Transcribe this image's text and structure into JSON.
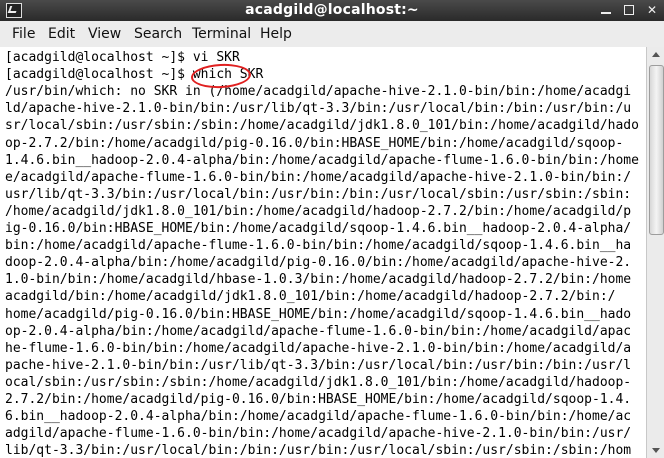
{
  "window": {
    "title": "acadgild@localhost:~",
    "app_icon": "terminal-icon",
    "buttons": [
      "minimize-icon",
      "maximize-icon",
      "close-icon"
    ]
  },
  "menubar": {
    "items": [
      "File",
      "Edit",
      "View",
      "Search",
      "Terminal",
      "Help"
    ]
  },
  "terminal": {
    "lines": [
      "[acadgild@localhost ~]$ vi SKR",
      "[acadgild@localhost ~]$ which SKR",
      "/usr/bin/which: no SKR in (/home/acadgild/apache-hive-2.1.0-bin/bin:/home/acadgi",
      "ld/apache-hive-2.1.0-bin/bin:/usr/lib/qt-3.3/bin:/usr/local/bin:/bin:/usr/bin:/u",
      "sr/local/sbin:/usr/sbin:/sbin:/home/acadgild/jdk1.8.0_101/bin:/home/acadgild/hado",
      "op-2.7.2/bin:/home/acadgild/pig-0.16.0/bin:HBASE_HOME/bin:/home/acadgild/sqoop-",
      "1.4.6.bin__hadoop-2.0.4-alpha/bin:/home/acadgild/apache-flume-1.6.0-bin/bin:/home",
      "e/acadgild/apache-flume-1.6.0-bin/bin:/home/acadgild/apache-hive-2.1.0-bin/bin:/",
      "usr/lib/qt-3.3/bin:/usr/local/bin:/usr/bin:/bin:/usr/local/sbin:/usr/sbin:/sbin:",
      "/home/acadgild/jdk1.8.0_101/bin:/home/acadgild/hadoop-2.7.2/bin:/home/acadgild/p",
      "ig-0.16.0/bin:HBASE_HOME/bin:/home/acadgild/sqoop-1.4.6.bin__hadoop-2.0.4-alpha/",
      "bin:/home/acadgild/apache-flume-1.6.0-bin/bin:/home/acadgild/sqoop-1.4.6.bin__ha",
      "doop-2.0.4-alpha/bin:/home/acadgild/pig-0.16.0/bin:/home/acadgild/apache-hive-2.",
      "1.0-bin/bin:/home/acadgild/hbase-1.0.3/bin:/home/acadgild/hadoop-2.7.2/bin:/home",
      "acadgild/bin:/home/acadgild/jdk1.8.0_101/bin:/home/acadgild/hadoop-2.7.2/bin:/",
      "home/acadgild/pig-0.16.0/bin:HBASE_HOME/bin:/home/acadgild/sqoop-1.4.6.bin__hado",
      "op-2.0.4-alpha/bin:/home/acadgild/apache-flume-1.6.0-bin/bin:/home/acadgild/apac",
      "he-flume-1.6.0-bin/bin:/home/acadgild/apache-hive-2.1.0-bin/bin:/home/acadgild/a",
      "pache-hive-2.1.0-bin/bin:/usr/lib/qt-3.3/bin:/usr/local/bin:/usr/bin:/bin:/usr/l",
      "ocal/sbin:/usr/sbin:/sbin:/home/acadgild/jdk1.8.0_101/bin:/home/acadgild/hadoop-",
      "2.7.2/bin:/home/acadgild/pig-0.16.0/bin:HBASE_HOME/bin:/home/acadgild/sqoop-1.4.",
      "6.bin__hadoop-2.0.4-alpha/bin:/home/acadgild/apache-flume-1.6.0-bin/bin:/home/ac",
      "adgild/apache-flume-1.6.0-bin/bin:/home/acadgild/apache-hive-2.1.0-bin/bin:/usr/",
      "lib/qt-3.3/bin:/usr/local/bin:/bin:/usr/bin:/usr/local/sbin:/usr/sbin:/sbin:/hom"
    ]
  },
  "annotation": {
    "color": "#e02020",
    "target": "which"
  },
  "colors": {
    "titlebar": "#2f2f2f",
    "menubar": "#ececec",
    "terminal_bg": "#ffffff",
    "text": "#000000"
  }
}
